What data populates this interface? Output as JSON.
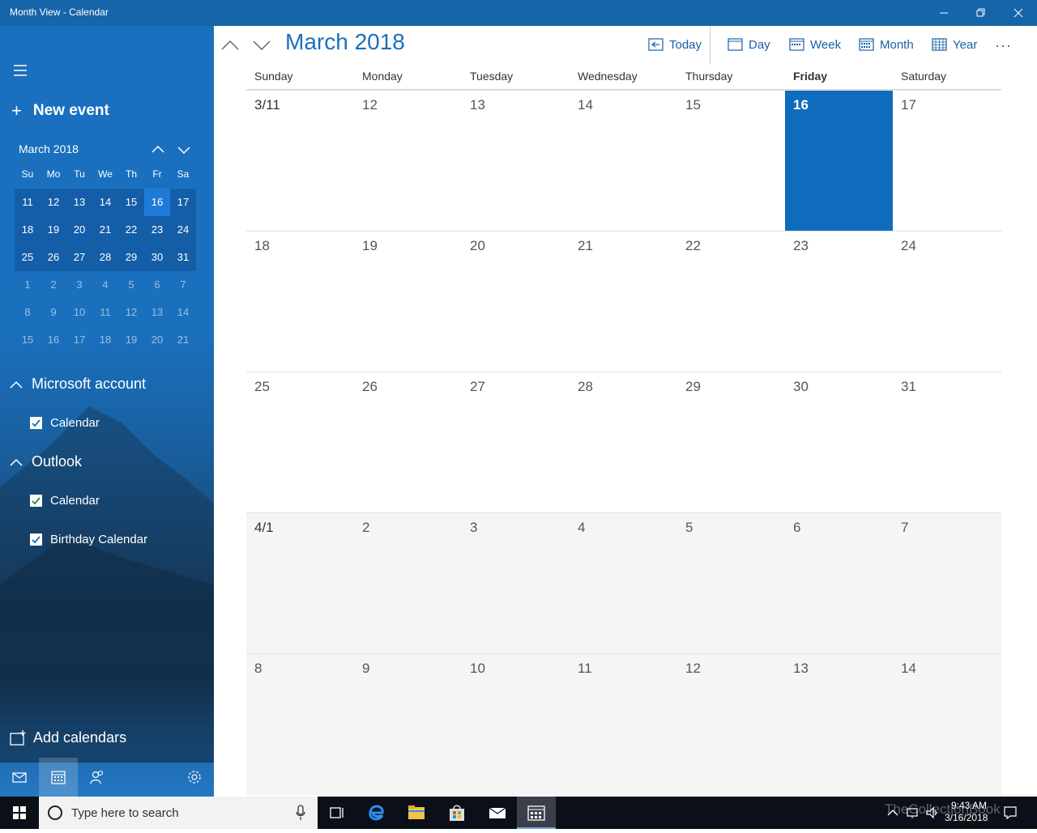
{
  "window": {
    "title": "Month View - Calendar"
  },
  "sidebar": {
    "new_event_label": "New event",
    "mini_calendar": {
      "title": "March 2018",
      "weekday_headers": [
        "Su",
        "Mo",
        "Tu",
        "We",
        "Th",
        "Fr",
        "Sa"
      ],
      "rows": [
        [
          "11",
          "12",
          "13",
          "14",
          "15",
          "16",
          "17"
        ],
        [
          "18",
          "19",
          "20",
          "21",
          "22",
          "23",
          "24"
        ],
        [
          "25",
          "26",
          "27",
          "28",
          "29",
          "30",
          "31"
        ],
        [
          "1",
          "2",
          "3",
          "4",
          "5",
          "6",
          "7"
        ],
        [
          "8",
          "9",
          "10",
          "11",
          "12",
          "13",
          "14"
        ],
        [
          "15",
          "16",
          "17",
          "18",
          "19",
          "20",
          "21"
        ]
      ]
    },
    "accounts": [
      {
        "name": "Microsoft account",
        "calendars": [
          {
            "label": "Calendar",
            "checked": true
          }
        ]
      },
      {
        "name": "Outlook",
        "calendars": [
          {
            "label": "Calendar",
            "checked": true
          },
          {
            "label": "Birthday Calendar",
            "checked": true
          }
        ]
      }
    ],
    "add_calendars_label": "Add calendars"
  },
  "header": {
    "month_title": "March 2018",
    "today_label": "Today",
    "day_label": "Day",
    "week_label": "Week",
    "month_label": "Month",
    "year_label": "Year",
    "more_label": "···"
  },
  "grid": {
    "weekday_headers": [
      "Sunday",
      "Monday",
      "Tuesday",
      "Wednesday",
      "Thursday",
      "Friday",
      "Saturday"
    ],
    "weeks": [
      [
        "3/11",
        "12",
        "13",
        "14",
        "15",
        "16",
        "17"
      ],
      [
        "18",
        "19",
        "20",
        "21",
        "22",
        "23",
        "24"
      ],
      [
        "25",
        "26",
        "27",
        "28",
        "29",
        "30",
        "31"
      ],
      [
        "4/1",
        "2",
        "3",
        "4",
        "5",
        "6",
        "7"
      ],
      [
        "8",
        "9",
        "10",
        "11",
        "12",
        "13",
        "14"
      ]
    ]
  },
  "taskbar": {
    "search_placeholder": "Type here to search",
    "time": "9:43 AM",
    "date": "3/16/2018",
    "watermark": "TheCollectionBook"
  },
  "colors": {
    "accent": "#0f6cbd",
    "title_bar": "#1565a8",
    "sidebar": "#1a6fbf"
  }
}
